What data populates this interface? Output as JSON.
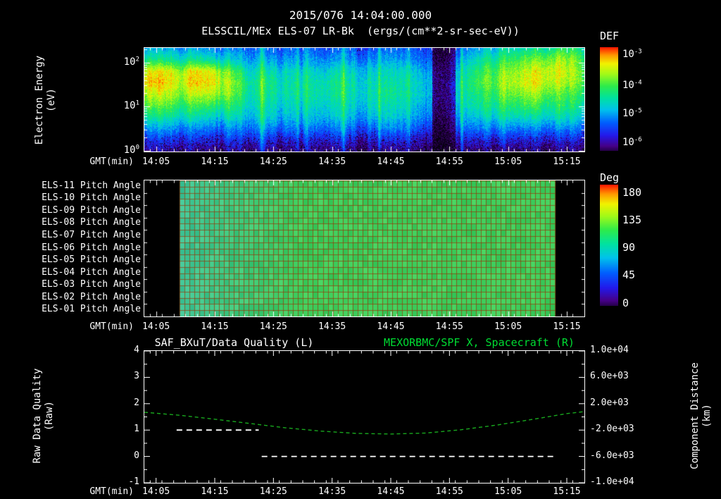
{
  "header": {
    "title": "2015/076 14:04:00.000",
    "subtitle": "ELSSCIL/MEx ELS-07 LR-Bk  (ergs/(cm**2-sr-sec-eV))"
  },
  "time_axis": {
    "label": "GMT(min)",
    "start": 843,
    "end": 918,
    "ticks": [
      {
        "minute": 845,
        "label": "14:05"
      },
      {
        "minute": 855,
        "label": "14:15"
      },
      {
        "minute": 865,
        "label": "14:25"
      },
      {
        "minute": 875,
        "label": "14:35"
      },
      {
        "minute": 885,
        "label": "14:45"
      },
      {
        "minute": 895,
        "label": "14:55"
      },
      {
        "minute": 905,
        "label": "15:05"
      },
      {
        "minute": 915,
        "label": "15:15"
      }
    ]
  },
  "colors": {
    "background": "#000000",
    "axis": "#ffffff",
    "text": "#ffffff",
    "title_green": "#00dd33",
    "spacecraft_line": "#18a81e",
    "quality_line": "#ffffff",
    "pitch_green": "#3ed06e"
  },
  "chart_data": [
    {
      "type": "heatmap",
      "name": "electron-energy-spectrogram",
      "ylabel": "Electron Energy",
      "ylabel2": "(eV)",
      "yscale": "log",
      "ylim_ev": [
        1,
        215
      ],
      "yticks": [
        {
          "exp": 2,
          "value": 100
        },
        {
          "exp": 1,
          "value": 10
        },
        {
          "exp": 0,
          "value": 1
        }
      ],
      "colorbar": {
        "title": "DEF",
        "units": "ergs/(cm**2-sr-sec-eV)",
        "tick_exps": [
          -3,
          -4,
          -5,
          -6
        ],
        "range_log10": [
          -3,
          -6
        ]
      },
      "grid_note": "normalized log flux (0 = 1e-6.5, 1 = 1e-3); rows top(~200eV) to bottom(~1eV); 26 time columns spanning 14:03-15:18",
      "streak_minutes": [
        863,
        869,
        877,
        883,
        897
      ],
      "dark_band": {
        "start_minute": 892,
        "end_minute": 896
      },
      "grid": [
        [
          0.38,
          0.42,
          0.36,
          0.4,
          0.34,
          0.3,
          0.28,
          0.3,
          0.28,
          0.28,
          0.28,
          0.3,
          0.28,
          0.28,
          0.3,
          0.28,
          0.26,
          0.18,
          0.3,
          0.4,
          0.46,
          0.52,
          0.55,
          0.58,
          0.6,
          0.55
        ],
        [
          0.55,
          0.58,
          0.52,
          0.56,
          0.5,
          0.42,
          0.36,
          0.38,
          0.35,
          0.35,
          0.35,
          0.38,
          0.35,
          0.35,
          0.38,
          0.35,
          0.32,
          0.22,
          0.38,
          0.52,
          0.58,
          0.65,
          0.7,
          0.74,
          0.76,
          0.66
        ],
        [
          0.8,
          0.86,
          0.76,
          0.86,
          0.8,
          0.62,
          0.46,
          0.5,
          0.46,
          0.46,
          0.46,
          0.5,
          0.46,
          0.46,
          0.48,
          0.46,
          0.4,
          0.28,
          0.46,
          0.62,
          0.68,
          0.76,
          0.82,
          0.85,
          0.8,
          0.7
        ],
        [
          0.86,
          0.9,
          0.8,
          0.9,
          0.84,
          0.7,
          0.52,
          0.56,
          0.5,
          0.5,
          0.52,
          0.56,
          0.5,
          0.5,
          0.52,
          0.5,
          0.44,
          0.32,
          0.5,
          0.66,
          0.72,
          0.8,
          0.85,
          0.82,
          0.76,
          0.7
        ],
        [
          0.76,
          0.82,
          0.72,
          0.8,
          0.76,
          0.66,
          0.5,
          0.55,
          0.5,
          0.5,
          0.52,
          0.55,
          0.5,
          0.52,
          0.55,
          0.5,
          0.44,
          0.33,
          0.5,
          0.6,
          0.66,
          0.72,
          0.76,
          0.72,
          0.66,
          0.62
        ],
        [
          0.66,
          0.7,
          0.62,
          0.66,
          0.62,
          0.56,
          0.46,
          0.5,
          0.46,
          0.46,
          0.48,
          0.5,
          0.46,
          0.48,
          0.5,
          0.46,
          0.4,
          0.3,
          0.46,
          0.56,
          0.6,
          0.62,
          0.66,
          0.62,
          0.6,
          0.56
        ],
        [
          0.52,
          0.56,
          0.5,
          0.52,
          0.46,
          0.46,
          0.4,
          0.45,
          0.4,
          0.4,
          0.42,
          0.45,
          0.4,
          0.42,
          0.45,
          0.4,
          0.35,
          0.25,
          0.4,
          0.46,
          0.5,
          0.52,
          0.52,
          0.52,
          0.5,
          0.46
        ],
        [
          0.36,
          0.4,
          0.35,
          0.36,
          0.32,
          0.32,
          0.3,
          0.34,
          0.3,
          0.3,
          0.32,
          0.34,
          0.3,
          0.3,
          0.34,
          0.3,
          0.26,
          0.18,
          0.3,
          0.34,
          0.36,
          0.36,
          0.36,
          0.36,
          0.35,
          0.34
        ],
        [
          0.22,
          0.24,
          0.21,
          0.22,
          0.19,
          0.19,
          0.18,
          0.21,
          0.18,
          0.18,
          0.19,
          0.21,
          0.18,
          0.18,
          0.2,
          0.18,
          0.15,
          0.11,
          0.18,
          0.2,
          0.21,
          0.21,
          0.21,
          0.21,
          0.2,
          0.2
        ],
        [
          0.11,
          0.13,
          0.11,
          0.11,
          0.09,
          0.09,
          0.08,
          0.1,
          0.08,
          0.08,
          0.09,
          0.1,
          0.08,
          0.08,
          0.1,
          0.08,
          0.07,
          0.05,
          0.08,
          0.1,
          0.1,
          0.1,
          0.1,
          0.1,
          0.1,
          0.1
        ]
      ]
    },
    {
      "type": "heatmap",
      "name": "pitch-angle-panels",
      "rows": [
        "ELS-11 Pitch Angle",
        "ELS-10 Pitch Angle",
        "ELS-09 Pitch Angle",
        "ELS-08 Pitch Angle",
        "ELS-07 Pitch Angle",
        "ELS-06 Pitch Angle",
        "ELS-05 Pitch Angle",
        "ELS-04 Pitch Angle",
        "ELS-03 Pitch Angle",
        "ELS-02 Pitch Angle",
        "ELS-01 Pitch Angle"
      ],
      "colorbar": {
        "title": "Deg",
        "ticks": [
          180,
          135,
          90,
          45,
          0
        ],
        "range": [
          0,
          180
        ]
      },
      "data_start_minute": 849,
      "data_end_minute": 913,
      "mean_pitch_deg": 95
    },
    {
      "type": "line",
      "name": "data-quality-and-spacecraft-position",
      "title_left": "SAF_BXuT/Data Quality (L)",
      "title_right": "MEXORBMC/SPF X, Spacecraft (R)",
      "left_axis": {
        "label_line1": "Raw Data Quality",
        "label_line2": "(Raw)",
        "ticks": [
          4,
          3,
          2,
          1,
          0,
          -1
        ],
        "lim": [
          -1,
          4
        ]
      },
      "right_axis": {
        "label_line1": "Component Distance",
        "label_line2": "(km)",
        "ticks": [
          "1.0e+04",
          "6.0e+03",
          "2.0e+03",
          "-2.0e+03",
          "-6.0e+03",
          "-1.0e+04"
        ],
        "tick_values": [
          10000,
          6000,
          2000,
          -2000,
          -6000,
          -10000
        ],
        "lim": [
          -10000,
          10000
        ]
      },
      "series": [
        {
          "name": "SAF_BXuT/Data Quality",
          "axis": "left",
          "style": "dashed",
          "color": "#ffffff",
          "segments": [
            {
              "value": 1,
              "start_minute": 848.5,
              "end_minute": 862.5
            },
            {
              "value": 0,
              "start_minute": 863,
              "end_minute": 913
            }
          ]
        },
        {
          "name": "MEXORBMC/SPF X",
          "axis": "right",
          "style": "dashed",
          "color": "#18a81e",
          "points_minute": [
            843,
            849,
            855,
            861,
            867,
            873,
            879,
            885,
            891,
            897,
            903,
            909,
            915,
            918
          ],
          "points_km": [
            700,
            250,
            -350,
            -1000,
            -1650,
            -2150,
            -2500,
            -2600,
            -2450,
            -1950,
            -1250,
            -400,
            500,
            800
          ]
        }
      ]
    }
  ]
}
